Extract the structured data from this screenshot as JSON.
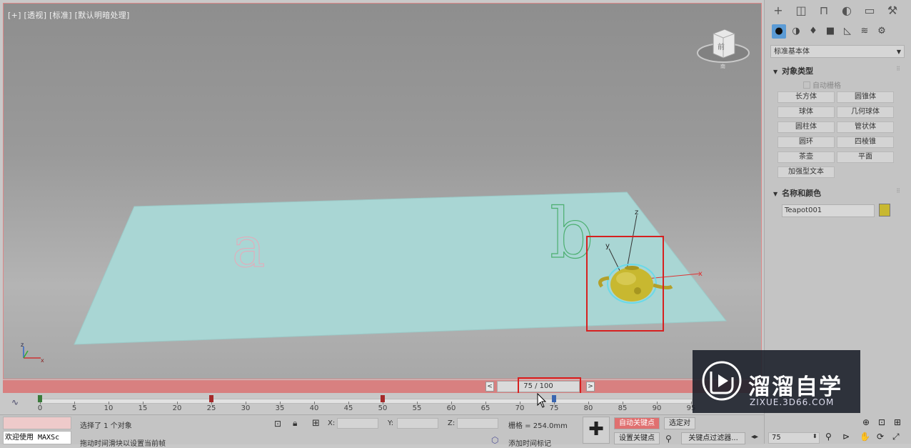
{
  "viewport": {
    "label": "[+] [透视] [标准] [默认明暗处理]",
    "scene_letter_a": "a",
    "scene_letter_b": "b",
    "axis_x": "x",
    "axis_y": "y",
    "axis_z": "z",
    "viewcube_label": "前",
    "compass_label": "南"
  },
  "command_panel": {
    "tabs": [
      "plus-icon",
      "modify-icon",
      "hierarchy-icon",
      "motion-icon",
      "display-icon",
      "utilities-icon"
    ],
    "subtabs": [
      "geometry-icon",
      "shapes-icon",
      "lights-icon",
      "cameras-icon",
      "helpers-icon",
      "spacewarps-icon",
      "systems-icon"
    ],
    "category": "标准基本体",
    "object_type_title": "对象类型",
    "autogrid_label": "自动栅格",
    "object_buttons": [
      "长方体",
      "圆锥体",
      "球体",
      "几何球体",
      "圆柱体",
      "管状体",
      "圆环",
      "四棱锥",
      "茶壶",
      "平面",
      "加强型文本"
    ],
    "name_color_title": "名称和颜色",
    "object_name": "Teapot001",
    "object_color": "#c8b830"
  },
  "time_slider": {
    "prev": "<",
    "next": ">",
    "position": "75 / 100",
    "current_frame": 75,
    "total_frames": 100
  },
  "track": {
    "ticks": [
      0,
      5,
      10,
      15,
      20,
      25,
      30,
      35,
      40,
      45,
      50,
      55,
      60,
      65,
      70,
      75,
      80,
      85,
      90,
      95
    ],
    "keys": [
      0,
      25,
      50,
      75
    ]
  },
  "status": {
    "maxscript": "欢迎使用 MAXSc",
    "selection_text": "选择了 1 个对象",
    "prompt_text": "拖动时间滑块以设置当前帧",
    "x_label": "X:",
    "y_label": "Y:",
    "z_label": "Z:",
    "grid_text": "栅格 = 254.0mm",
    "add_time_tag": "添加时间标记",
    "auto_key": "自动关键点",
    "selected_obj": "选定对",
    "set_key": "设置关键点",
    "key_filters": "关键点过滤器...",
    "frame_value": "75"
  },
  "watermark": {
    "title": "溜溜自学",
    "url": "ZIXUE.3D66.COM"
  },
  "colors": {
    "accent_red": "#d62020",
    "time_bar": "#d88080",
    "plane": "#a9d6d4",
    "teapot": "#c8b830"
  }
}
